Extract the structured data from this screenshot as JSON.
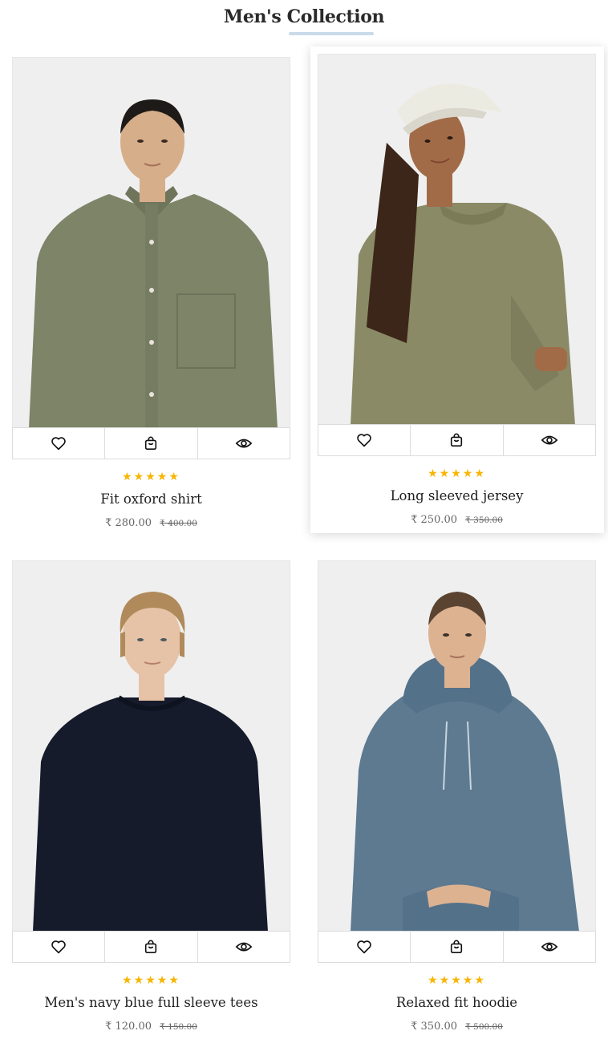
{
  "section": {
    "title": "Men's Collection"
  },
  "currency": "₹",
  "products": [
    {
      "name": "Fit oxford shirt",
      "rating": "★★★★★",
      "price": "₹ 280.00",
      "old_price": "₹ 400.00",
      "garment_color": "#7d8468",
      "skin_color": "#d7ae8a",
      "hair_color": "#1d1a17"
    },
    {
      "name": "Long sleeved jersey",
      "rating": "★★★★★",
      "price": "₹ 250.00",
      "old_price": "₹ 350.00",
      "garment_color": "#8a8a66",
      "skin_color": "#a26b48",
      "hair_color": "#3b2619"
    },
    {
      "name": "Men's navy blue full sleeve tees",
      "rating": "★★★★★",
      "price": "₹ 120.00",
      "old_price": "₹ 150.00",
      "garment_color": "#161b2c",
      "skin_color": "#e6c2a6",
      "hair_color": "#b08a5a"
    },
    {
      "name": "Relaxed fit hoodie",
      "rating": "★★★★★",
      "price": "₹ 350.00",
      "old_price": "₹ 500.00",
      "garment_color": "#5d7a91",
      "skin_color": "#dcb291",
      "hair_color": "#5a4330"
    }
  ],
  "icons": {
    "wishlist": "heart-icon",
    "cart": "shopping-bag-icon",
    "quick_view": "eye-icon"
  },
  "colors": {
    "star": "#f7b500",
    "underline": "#c9dbe9",
    "photo_bg": "#f0f0f0"
  }
}
